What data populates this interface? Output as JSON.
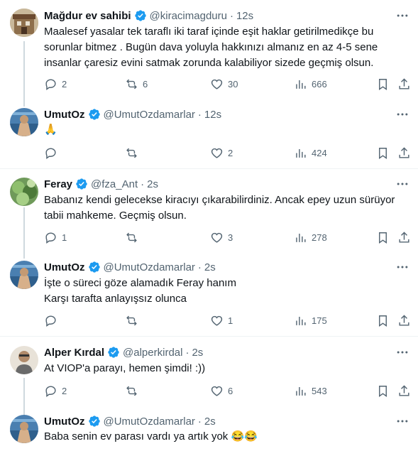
{
  "tweets": [
    {
      "name": "Mağdur ev sahibi",
      "handle": "@kiracimagduru",
      "time": "12s",
      "text": [
        "Maalesef yasalar tek taraflı iki taraf içinde eşit haklar getirilmedikçe bu",
        "sorunlar bitmez . Bugün dava yoluyla hakkınızı almanız en az 4-5 sene",
        "insanlar çaresiz evini satmak zorunda kalabiliyor sizede geçmiş olsun."
      ],
      "replies": "2",
      "retweets": "6",
      "likes": "30",
      "views": "666"
    },
    {
      "name": "UmutOz",
      "handle": "@UmutOzdamarlar",
      "time": "12s",
      "text": [
        "🙏"
      ],
      "replies": "",
      "retweets": "",
      "likes": "2",
      "views": "424"
    },
    {
      "name": "Feray",
      "handle": "@fza_Ant",
      "time": "2s",
      "text": [
        "Babanız kendi gelecekse kiracıyı çıkarabilirdiniz. Ancak epey uzun sürüyor",
        "tabii mahkeme. Geçmiş olsun."
      ],
      "replies": "1",
      "retweets": "",
      "likes": "3",
      "views": "278"
    },
    {
      "name": "UmutOz",
      "handle": "@UmutOzdamarlar",
      "time": "2s",
      "text": [
        "İşte o süreci göze alamadık Feray hanım",
        "Karşı tarafta anlayışsız olunca"
      ],
      "replies": "",
      "retweets": "",
      "likes": "1",
      "views": "175"
    },
    {
      "name": "Alper Kırdal",
      "handle": "@alperkirdal",
      "time": "2s",
      "text": [
        "At VIOP'a parayı, hemen şimdi! :))"
      ],
      "replies": "2",
      "retweets": "",
      "likes": "6",
      "views": "543"
    },
    {
      "name": "UmutOz",
      "handle": "@UmutOzdamarlar",
      "time": "2s",
      "text": [
        "Baba senin ev parası vardı ya artık yok 😂😂"
      ],
      "replies": "",
      "retweets": "",
      "likes": "",
      "views": ""
    }
  ],
  "colors": {
    "verified": "#1d9bf0",
    "muted": "#536471",
    "text": "#0f1419",
    "line": "#cfd9de"
  },
  "icons": {
    "reply": "reply-icon",
    "retweet": "retweet-icon",
    "like": "heart-icon",
    "views": "views-icon",
    "bookmark": "bookmark-icon",
    "share": "share-icon",
    "more": "more-icon",
    "verified": "verified-badge-icon"
  }
}
